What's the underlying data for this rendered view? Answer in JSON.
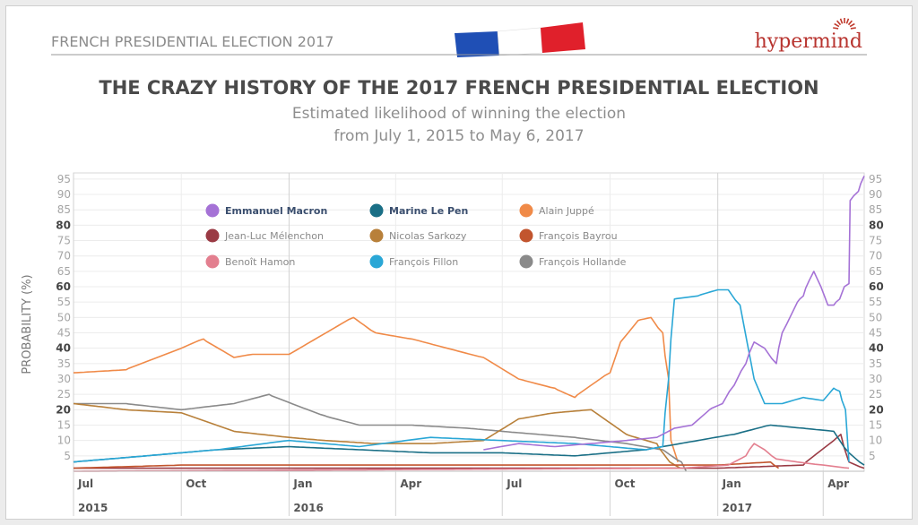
{
  "header": {
    "tag": "FRENCH PRESIDENTIAL ELECTION 2017",
    "brand": "hypermind",
    "flag_colors": [
      "#1f4fb5",
      "#ffffff",
      "#e0202b"
    ]
  },
  "title": "THE CRAZY HISTORY OF THE 2017 FRENCH PRESIDENTIAL ELECTION",
  "subtitle_line1": "Estimated likelihood of winning the election",
  "subtitle_line2": "from July 1, 2015 to May 6, 2017",
  "chart_data": {
    "type": "line",
    "ylabel": "PROBABILITY (%)",
    "xlim": [
      "2015-07-01",
      "2017-05-06"
    ],
    "ylim": [
      0,
      97
    ],
    "grid": true,
    "legend_position": "top-left",
    "y_ticks": [
      5,
      10,
      15,
      20,
      25,
      30,
      35,
      40,
      45,
      50,
      55,
      60,
      65,
      70,
      75,
      80,
      85,
      90,
      95
    ],
    "y_ticks_bold": [
      20,
      40,
      60,
      80
    ],
    "x_ticks": [
      {
        "label": "Jul",
        "date": "2015-07-01",
        "year": "2015"
      },
      {
        "label": "Oct",
        "date": "2015-10-01"
      },
      {
        "label": "Jan",
        "date": "2016-01-01",
        "year": "2016"
      },
      {
        "label": "Apr",
        "date": "2016-04-01"
      },
      {
        "label": "Jul",
        "date": "2016-07-01"
      },
      {
        "label": "Oct",
        "date": "2016-10-01"
      },
      {
        "label": "Jan",
        "date": "2017-01-01",
        "year": "2017"
      },
      {
        "label": "Apr",
        "date": "2017-04-01"
      }
    ],
    "series": [
      {
        "name": "Emmanuel Macron",
        "color": "#a572d6",
        "bold": true,
        "points": [
          [
            "2016-06-15",
            7
          ],
          [
            "2016-07-15",
            9
          ],
          [
            "2016-08-15",
            8
          ],
          [
            "2016-09-15",
            9
          ],
          [
            "2016-10-15",
            10
          ],
          [
            "2016-11-10",
            11
          ],
          [
            "2016-11-25",
            14
          ],
          [
            "2016-12-10",
            15
          ],
          [
            "2016-12-25",
            20
          ],
          [
            "2017-01-05",
            22
          ],
          [
            "2017-01-15",
            28
          ],
          [
            "2017-01-25",
            35
          ],
          [
            "2017-02-01",
            42
          ],
          [
            "2017-02-10",
            40
          ],
          [
            "2017-02-20",
            35
          ],
          [
            "2017-02-25",
            45
          ],
          [
            "2017-03-01",
            48
          ],
          [
            "2017-03-10",
            55
          ],
          [
            "2017-03-15",
            57
          ],
          [
            "2017-03-20",
            62
          ],
          [
            "2017-03-24",
            65
          ],
          [
            "2017-03-30",
            60
          ],
          [
            "2017-04-02",
            57
          ],
          [
            "2017-04-05",
            54
          ],
          [
            "2017-04-10",
            54
          ],
          [
            "2017-04-15",
            56
          ],
          [
            "2017-04-19",
            60
          ],
          [
            "2017-04-23",
            61
          ],
          [
            "2017-04-24",
            88
          ],
          [
            "2017-05-01",
            91
          ],
          [
            "2017-05-06",
            96
          ]
        ]
      },
      {
        "name": "Marine Le Pen",
        "color": "#1a6f86",
        "bold": true,
        "points": [
          [
            "2015-07-01",
            3
          ],
          [
            "2015-09-01",
            5
          ],
          [
            "2015-11-01",
            7
          ],
          [
            "2016-01-01",
            8
          ],
          [
            "2016-03-01",
            7
          ],
          [
            "2016-05-01",
            6
          ],
          [
            "2016-07-01",
            6
          ],
          [
            "2016-09-01",
            5
          ],
          [
            "2016-11-01",
            7
          ],
          [
            "2016-12-15",
            10
          ],
          [
            "2017-01-15",
            12
          ],
          [
            "2017-02-15",
            15
          ],
          [
            "2017-03-15",
            14
          ],
          [
            "2017-04-10",
            13
          ],
          [
            "2017-04-23",
            6
          ],
          [
            "2017-05-06",
            2
          ]
        ]
      },
      {
        "name": "Alain Juppé",
        "color": "#f08a48",
        "bold": false,
        "points": [
          [
            "2015-07-01",
            32
          ],
          [
            "2015-08-15",
            33
          ],
          [
            "2015-10-01",
            40
          ],
          [
            "2015-10-20",
            43
          ],
          [
            "2015-11-15",
            37
          ],
          [
            "2015-12-01",
            38
          ],
          [
            "2016-01-01",
            38
          ],
          [
            "2016-02-15",
            48
          ],
          [
            "2016-02-25",
            50
          ],
          [
            "2016-03-15",
            45
          ],
          [
            "2016-04-15",
            43
          ],
          [
            "2016-05-15",
            40
          ],
          [
            "2016-06-15",
            37
          ],
          [
            "2016-07-15",
            30
          ],
          [
            "2016-08-15",
            27
          ],
          [
            "2016-09-01",
            24
          ],
          [
            "2016-09-15",
            28
          ],
          [
            "2016-10-01",
            32
          ],
          [
            "2016-10-10",
            42
          ],
          [
            "2016-10-25",
            49
          ],
          [
            "2016-11-05",
            50
          ],
          [
            "2016-11-15",
            45
          ],
          [
            "2016-11-20",
            30
          ],
          [
            "2016-11-22",
            10
          ],
          [
            "2016-11-28",
            3
          ]
        ]
      },
      {
        "name": "Jean-Luc Mélenchon",
        "color": "#9a3a44",
        "bold": false,
        "points": [
          [
            "2015-07-01",
            1
          ],
          [
            "2016-06-01",
            1
          ],
          [
            "2017-01-01",
            1
          ],
          [
            "2017-03-15",
            2
          ],
          [
            "2017-04-10",
            10
          ],
          [
            "2017-04-16",
            12
          ],
          [
            "2017-04-23",
            3
          ],
          [
            "2017-05-06",
            1
          ]
        ]
      },
      {
        "name": "Nicolas Sarkozy",
        "color": "#b8803a",
        "bold": false,
        "points": [
          [
            "2015-07-01",
            22
          ],
          [
            "2015-08-15",
            20
          ],
          [
            "2015-10-01",
            19
          ],
          [
            "2015-11-15",
            13
          ],
          [
            "2016-01-01",
            11
          ],
          [
            "2016-02-01",
            10
          ],
          [
            "2016-03-15",
            9
          ],
          [
            "2016-05-01",
            9
          ],
          [
            "2016-06-15",
            10
          ],
          [
            "2016-07-15",
            17
          ],
          [
            "2016-08-15",
            19
          ],
          [
            "2016-09-15",
            20
          ],
          [
            "2016-10-15",
            12
          ],
          [
            "2016-11-10",
            9
          ],
          [
            "2016-11-21",
            3
          ],
          [
            "2016-11-30",
            1
          ]
        ]
      },
      {
        "name": "François Bayrou",
        "color": "#c2552e",
        "bold": false,
        "points": [
          [
            "2015-07-01",
            1
          ],
          [
            "2015-10-01",
            2
          ],
          [
            "2016-01-01",
            2
          ],
          [
            "2016-04-01",
            2
          ],
          [
            "2016-07-01",
            2
          ],
          [
            "2016-10-01",
            2
          ],
          [
            "2017-01-01",
            2
          ],
          [
            "2017-02-15",
            3
          ],
          [
            "2017-02-22",
            1
          ]
        ]
      },
      {
        "name": "Benoît Hamon",
        "color": "#e37f8f",
        "bold": false,
        "points": [
          [
            "2015-07-01",
            0
          ],
          [
            "2016-12-01",
            1
          ],
          [
            "2017-01-10",
            2
          ],
          [
            "2017-01-25",
            5
          ],
          [
            "2017-02-01",
            9
          ],
          [
            "2017-02-10",
            7
          ],
          [
            "2017-02-20",
            4
          ],
          [
            "2017-03-10",
            3
          ],
          [
            "2017-04-01",
            2
          ],
          [
            "2017-04-23",
            1
          ]
        ]
      },
      {
        "name": "François Fillon",
        "color": "#2aa7d6",
        "bold": false,
        "points": [
          [
            "2015-07-01",
            3
          ],
          [
            "2015-09-01",
            5
          ],
          [
            "2015-11-01",
            7
          ],
          [
            "2016-01-01",
            10
          ],
          [
            "2016-03-01",
            8
          ],
          [
            "2016-05-01",
            11
          ],
          [
            "2016-07-01",
            10
          ],
          [
            "2016-09-01",
            9
          ],
          [
            "2016-11-01",
            7
          ],
          [
            "2016-11-15",
            8
          ],
          [
            "2016-11-20",
            30
          ],
          [
            "2016-11-25",
            56
          ],
          [
            "2016-12-15",
            57
          ],
          [
            "2017-01-01",
            59
          ],
          [
            "2017-01-10",
            59
          ],
          [
            "2017-01-20",
            54
          ],
          [
            "2017-01-26",
            42
          ],
          [
            "2017-02-01",
            30
          ],
          [
            "2017-02-10",
            22
          ],
          [
            "2017-02-25",
            22
          ],
          [
            "2017-03-15",
            24
          ],
          [
            "2017-04-01",
            23
          ],
          [
            "2017-04-10",
            27
          ],
          [
            "2017-04-15",
            26
          ],
          [
            "2017-04-20",
            20
          ],
          [
            "2017-04-23",
            3
          ]
        ]
      },
      {
        "name": "François Hollande",
        "color": "#8a8a8a",
        "bold": false,
        "points": [
          [
            "2015-07-01",
            22
          ],
          [
            "2015-08-15",
            22
          ],
          [
            "2015-10-01",
            20
          ],
          [
            "2015-11-15",
            22
          ],
          [
            "2015-12-15",
            25
          ],
          [
            "2016-01-10",
            21
          ],
          [
            "2016-02-01",
            18
          ],
          [
            "2016-03-01",
            15
          ],
          [
            "2016-04-15",
            15
          ],
          [
            "2016-06-01",
            14
          ],
          [
            "2016-07-01",
            13
          ],
          [
            "2016-09-01",
            11
          ],
          [
            "2016-10-15",
            9
          ],
          [
            "2016-11-15",
            7
          ],
          [
            "2016-12-01",
            3
          ],
          [
            "2016-12-05",
            0
          ]
        ]
      }
    ]
  }
}
